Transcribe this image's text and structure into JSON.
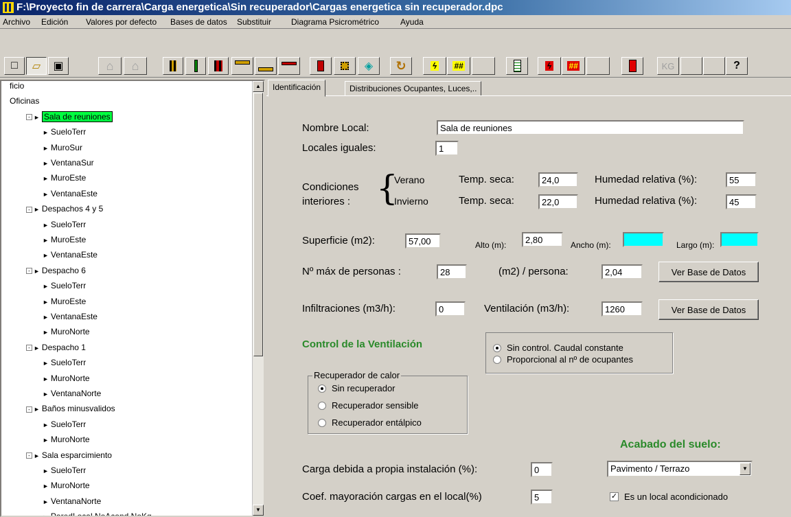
{
  "window": {
    "title": "F:\\Proyecto fin de carrera\\Carga energetica\\Sin recuperador\\Cargas energetica sin recuperador.dpc"
  },
  "menu": [
    "Archivo",
    "Edición",
    "Valores por defecto",
    "Bases de datos",
    "Substituir",
    "Diagrama Psicrométrico",
    "Ayuda"
  ],
  "toolbar": {
    "icons": [
      "new-icon",
      "open-icon",
      "save-icon",
      "building-icon",
      "house-icon",
      "wall-icon",
      "column-icon",
      "wall-red-icon",
      "window-icon",
      "floor-icon",
      "roof-icon",
      "door-icon",
      "chip-icon",
      "diamond-icon",
      "cycle-icon",
      "lightning-icon",
      "hatch-icon",
      "document-icon",
      "lightning-red-icon",
      "hatch-red-icon",
      "document-red-icon",
      "kg-icon",
      "help-icon"
    ],
    "kg_label": "KG",
    "help_label": "?"
  },
  "tree": {
    "nodes": [
      {
        "level": 0,
        "label": "ficio",
        "expander": "",
        "arrow": false
      },
      {
        "level": 0,
        "label": "Oficinas",
        "expander": "",
        "arrow": false
      },
      {
        "level": 1,
        "label": "Sala de reuniones",
        "expander": "-",
        "arrow": true,
        "selected": true
      },
      {
        "level": 2,
        "label": "SueloTerr",
        "arrow": true
      },
      {
        "level": 2,
        "label": "MuroSur",
        "arrow": true
      },
      {
        "level": 2,
        "label": "VentanaSur",
        "arrow": true
      },
      {
        "level": 2,
        "label": "MuroEste",
        "arrow": true
      },
      {
        "level": 2,
        "label": "VentanaEste",
        "arrow": true
      },
      {
        "level": 1,
        "label": "Despachos 4 y 5",
        "expander": "-",
        "arrow": true
      },
      {
        "level": 2,
        "label": "SueloTerr",
        "arrow": true
      },
      {
        "level": 2,
        "label": "MuroEste",
        "arrow": true
      },
      {
        "level": 2,
        "label": "VentanaEste",
        "arrow": true
      },
      {
        "level": 1,
        "label": "Despacho 6",
        "expander": "-",
        "arrow": true
      },
      {
        "level": 2,
        "label": "SueloTerr",
        "arrow": true
      },
      {
        "level": 2,
        "label": "MuroEste",
        "arrow": true
      },
      {
        "level": 2,
        "label": "VentanaEste",
        "arrow": true
      },
      {
        "level": 2,
        "label": "MuroNorte",
        "arrow": true
      },
      {
        "level": 1,
        "label": "Despacho 1",
        "expander": "-",
        "arrow": true
      },
      {
        "level": 2,
        "label": "SueloTerr",
        "arrow": true
      },
      {
        "level": 2,
        "label": "MuroNorte",
        "arrow": true
      },
      {
        "level": 2,
        "label": "VentanaNorte",
        "arrow": true
      },
      {
        "level": 1,
        "label": "Baños minusvalidos",
        "expander": "-",
        "arrow": true
      },
      {
        "level": 2,
        "label": "SueloTerr",
        "arrow": true
      },
      {
        "level": 2,
        "label": "MuroNorte",
        "arrow": true
      },
      {
        "level": 1,
        "label": "Sala esparcimiento",
        "expander": "-",
        "arrow": true
      },
      {
        "level": 2,
        "label": "SueloTerr",
        "arrow": true
      },
      {
        "level": 2,
        "label": "MuroNorte",
        "arrow": true
      },
      {
        "level": 2,
        "label": "VentanaNorte",
        "arrow": true
      },
      {
        "level": 2,
        "label": "ParedLocal NoAcond NoKg",
        "arrow": true
      }
    ]
  },
  "tabs": [
    {
      "label": "Identificación",
      "active": true
    },
    {
      "label": "Distribuciones Ocupantes, Luces,..",
      "active": false
    }
  ],
  "form": {
    "nombre_local_label": "Nombre Local:",
    "nombre_local_value": "Sala de reuniones",
    "locales_iguales_label": "Locales iguales:",
    "locales_iguales_value": "1",
    "condiciones_label_1": "Condiciones",
    "condiciones_label_2": "interiores :",
    "verano_label": "Verano",
    "invierno_label": "Invierno",
    "temp_seca_label": "Temp. seca:",
    "humedad_label": "Humedad relativa (%):",
    "verano_temp": "24,0",
    "verano_humedad": "55",
    "invierno_temp": "22,0",
    "invierno_humedad": "45",
    "superficie_label": "Superficie (m2):",
    "superficie_value": "57,00",
    "alto_label": "Alto (m):",
    "alto_value": "2,80",
    "ancho_label": "Ancho (m):",
    "ancho_value": "",
    "largo_label": "Largo (m):",
    "largo_value": "",
    "max_personas_label": "Nº máx de personas :",
    "max_personas_value": "28",
    "m2_persona_label": "(m2) / persona:",
    "m2_persona_value": "2,04",
    "ver_bd_1": "Ver Base de Datos",
    "infiltraciones_label": "Infiltraciones (m3/h):",
    "infiltraciones_value": "0",
    "ventilacion_label": "Ventilación (m3/h):",
    "ventilacion_value": "1260",
    "ver_bd_2": "Ver Base de Datos",
    "control_ventilacion_title": "Control de la Ventilación",
    "control_options": [
      {
        "label": "Sin control. Caudal constante",
        "checked": true
      },
      {
        "label": "Proporcional al nº de ocupantes",
        "checked": false
      }
    ],
    "recuperador_title": "Recuperador de calor",
    "recuperador_options": [
      {
        "label": "Sin recuperador",
        "checked": true
      },
      {
        "label": "Recuperador sensible",
        "checked": false
      },
      {
        "label": "Recuperador entálpico",
        "checked": false
      }
    ],
    "acabado_title": "Acabado del suelo:",
    "acabado_value": "Pavimento / Terrazo",
    "carga_label": "Carga debida a propia  instalación (%):",
    "carga_value": "0",
    "coef_label": "Coef. mayoración cargas en el local(%)",
    "coef_value": "5",
    "acondicionado_label": "Es un local acondicionado",
    "acondicionado_checked": true
  }
}
